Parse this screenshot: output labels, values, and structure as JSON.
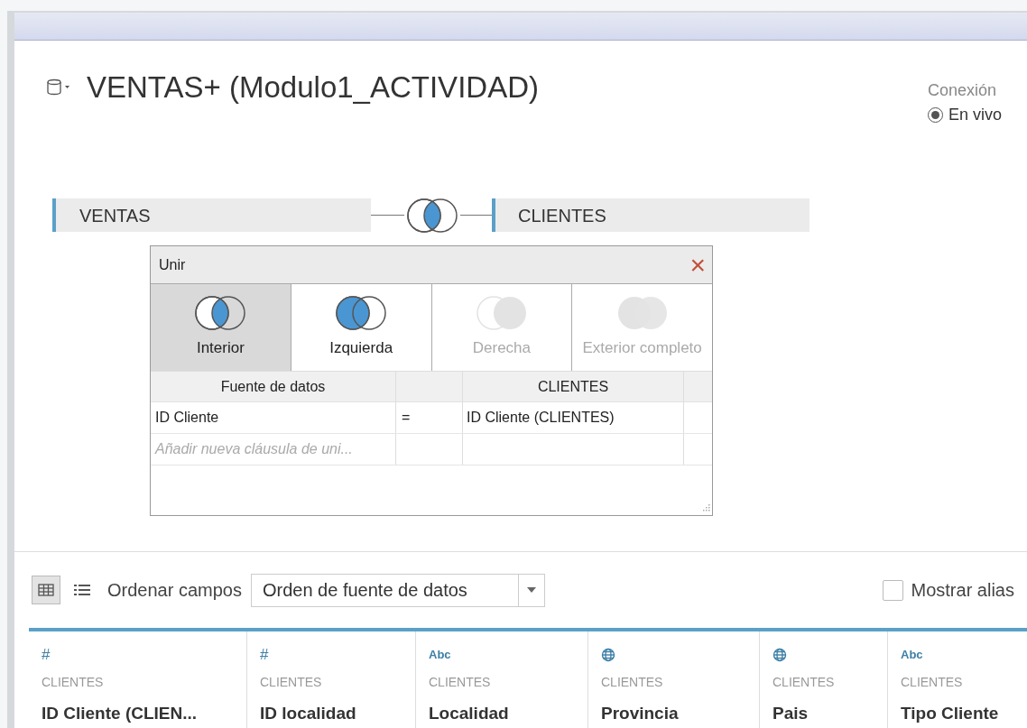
{
  "datasource": {
    "title": "VENTAS+ (Modulo1_ACTIVIDAD)"
  },
  "connection": {
    "label": "Conexión",
    "option": "En vivo",
    "selected": true
  },
  "join_bar": {
    "left_table": "VENTAS",
    "right_table": "CLIENTES",
    "kind": "inner"
  },
  "join_dialog": {
    "title": "Unir",
    "close": "×",
    "join_types": [
      {
        "kind": "inner",
        "label": "Interior",
        "selected": true,
        "disabled": false
      },
      {
        "kind": "left",
        "label": "Izquierda",
        "selected": false,
        "disabled": false
      },
      {
        "kind": "right",
        "label": "Derecha",
        "selected": false,
        "disabled": true
      },
      {
        "kind": "full",
        "label": "Exterior completo",
        "selected": false,
        "disabled": true
      }
    ],
    "columns": [
      "Fuente de datos",
      "",
      "CLIENTES"
    ],
    "clauses": [
      {
        "left": "ID Cliente",
        "op": "=",
        "right": "ID Cliente (CLIENTES)"
      }
    ],
    "add_clause_placeholder": "Añadir nueva cláusula de uni..."
  },
  "toolbar": {
    "views": [
      {
        "kind": "grid",
        "selected": true
      },
      {
        "kind": "list",
        "selected": false
      }
    ],
    "sort_label": "Ordenar campos",
    "sort_value": "Orden de fuente de datos",
    "show_alias": {
      "label": "Mostrar alias",
      "checked": false
    }
  },
  "fields": [
    {
      "kind": "number",
      "type_label": "#",
      "table": "CLIENTES",
      "name": "ID Cliente (CLIEN..."
    },
    {
      "kind": "number",
      "type_label": "#",
      "table": "CLIENTES",
      "name": "ID localidad"
    },
    {
      "kind": "string",
      "type_label": "Abc",
      "table": "CLIENTES",
      "name": "Localidad"
    },
    {
      "kind": "geo",
      "table": "CLIENTES",
      "name": "Provincia"
    },
    {
      "kind": "geo",
      "table": "CLIENTES",
      "name": "Pais"
    },
    {
      "kind": "string",
      "type_label": "Abc",
      "table": "CLIENTES",
      "name": "Tipo Cliente"
    }
  ]
}
